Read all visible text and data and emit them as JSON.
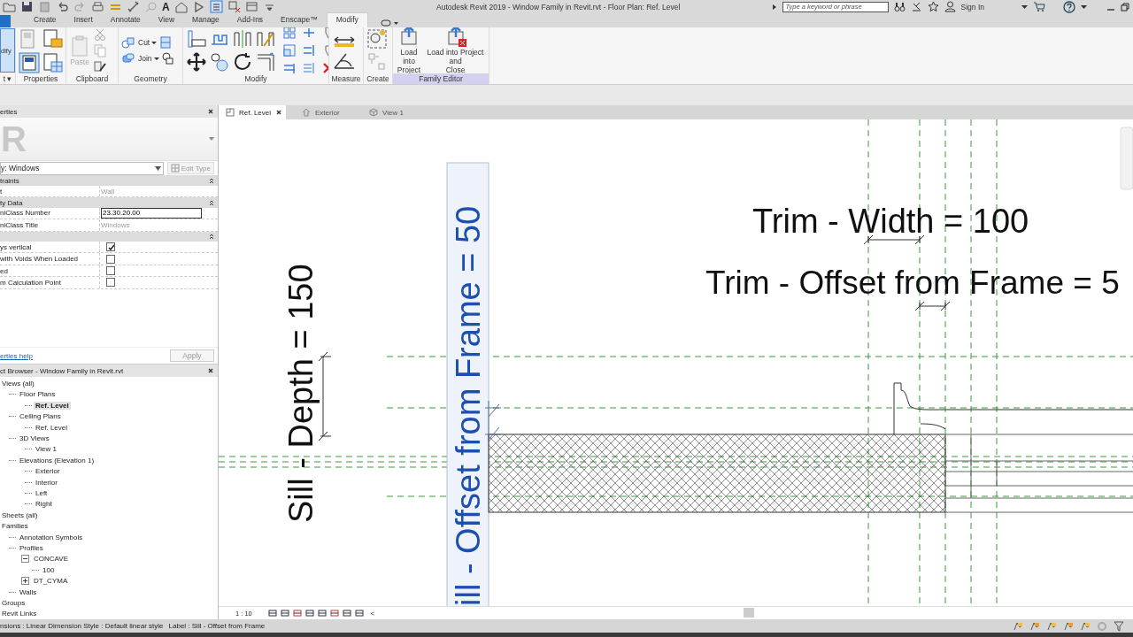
{
  "title_bar": {
    "text_tool": "A",
    "title": "Autodesk Revit 2019 - Window Family in Revit.rvt - Floor Plan: Ref. Level",
    "search": {
      "placeholder": "Type a keyword or phrase"
    },
    "sign_in": "Sign In"
  },
  "ribbon": {
    "tabs": [
      {
        "label": "Create",
        "selected": false
      },
      {
        "label": "Insert",
        "selected": false
      },
      {
        "label": "Annotate",
        "selected": false
      },
      {
        "label": "View",
        "selected": false
      },
      {
        "label": "Manage",
        "selected": false
      },
      {
        "label": "Add-Ins",
        "selected": false
      },
      {
        "label": "Enscape™",
        "selected": false
      },
      {
        "label": "Modify",
        "selected": true
      }
    ],
    "panels": [
      {
        "label": "t ▾",
        "contextual": false,
        "buttons": [
          {
            "label": "dify",
            "active": true
          }
        ]
      },
      {
        "label": "Properties",
        "contextual": false
      },
      {
        "label": "Clipboard",
        "contextual": false,
        "buttons": [
          {
            "label": "Paste",
            "disabled": true
          }
        ]
      },
      {
        "label": "Geometry",
        "contextual": false,
        "buttons": [
          {
            "label": "Cut",
            "disabled": false
          },
          {
            "label": "Join",
            "disabled": false
          }
        ]
      },
      {
        "label": "Modify",
        "contextual": false
      },
      {
        "label": "Measure",
        "contextual": false
      },
      {
        "label": "Create",
        "contextual": false
      },
      {
        "label": "Family Editor",
        "contextual": true,
        "buttons": [
          {
            "label": "Load into Project"
          },
          {
            "label": "Load into Project and Close"
          }
        ]
      }
    ]
  },
  "properties": {
    "title": "erties",
    "type_logo": "R",
    "type_selector": "y: Windows",
    "edit_type": {
      "label": "Edit Type",
      "disabled": true
    },
    "groups": [
      {
        "label": "traints",
        "rows": [
          {
            "kind": "text",
            "name": "t",
            "value": "Wall",
            "read_only": true
          }
        ]
      },
      {
        "label": "ty Data",
        "rows": [
          {
            "kind": "text",
            "name": "niClass Number",
            "value": "23.30.20.00",
            "read_only": false
          },
          {
            "kind": "text",
            "name": "niClass Title",
            "value": "Windows",
            "read_only": true
          }
        ]
      },
      {
        "rows": [
          {
            "kind": "checkbox",
            "name": "ys vertical",
            "checked": true
          },
          {
            "kind": "checkbox",
            "name": "with Voids When Loaded",
            "checked": false
          },
          {
            "kind": "checkbox",
            "name": "ed",
            "checked": false
          },
          {
            "kind": "checkbox",
            "name": "m Calculation Point",
            "checked": false
          }
        ]
      }
    ],
    "help_link": "erties help",
    "apply": {
      "label": "Apply",
      "disabled": true
    }
  },
  "browser": {
    "title": "ct Browser - Window Family in Revit.rvt",
    "tree": [
      {
        "label": "Views (all)",
        "selected": false,
        "children": [
          {
            "label": "Floor Plans",
            "selected": false,
            "children": [
              {
                "label": "Ref. Level",
                "selected": true
              }
            ]
          },
          {
            "label": "Ceiling Plans",
            "selected": false,
            "children": [
              {
                "label": "Ref. Level",
                "selected": false
              }
            ]
          },
          {
            "label": "3D Views",
            "selected": false,
            "children": [
              {
                "label": "View 1",
                "selected": false
              }
            ]
          },
          {
            "label": "Elevations (Elevation 1)",
            "selected": false,
            "children": [
              {
                "label": "Exterior",
                "selected": false
              },
              {
                "label": "Interior",
                "selected": false
              },
              {
                "label": "Left",
                "selected": false
              },
              {
                "label": "Right",
                "selected": false
              }
            ]
          }
        ]
      },
      {
        "label": "Sheets (all)",
        "selected": false
      },
      {
        "label": "Families",
        "selected": false,
        "children": [
          {
            "label": "Annotation Symbols",
            "selected": false
          },
          {
            "label": "Profiles",
            "selected": false,
            "children": [
              {
                "label": "CONCAVE",
                "selected": false,
                "expanded": true,
                "children": [
                  {
                    "label": "100",
                    "selected": false
                  }
                ]
              },
              {
                "label": "DT_CYMA",
                "selected": false,
                "expanded": false
              }
            ]
          },
          {
            "label": "Walls",
            "selected": false
          }
        ]
      },
      {
        "label": "Groups",
        "selected": false
      },
      {
        "label": "Revit Links",
        "selected": false
      }
    ]
  },
  "view": {
    "tabs": [
      {
        "label": "Ref. Level",
        "selected": true
      },
      {
        "label": "Exterior",
        "selected": false
      },
      {
        "label": "View 1",
        "selected": false
      }
    ],
    "labels": [
      {
        "text": "Trim - Width = 100",
        "selected": false
      },
      {
        "text": "Trim - Offset from Frame = 5",
        "selected": false
      },
      {
        "text": "Sill - Depth = 150",
        "selected": false
      },
      {
        "text": "ill - Offset from Frame = 50",
        "selected": true
      }
    ],
    "scale": "1 : 10",
    "collapse": "<"
  },
  "status_bar": {
    "message": "nsions : Linear Dimension Style : Default linear style",
    "label": "Label : Sill - Offset from Frame"
  }
}
